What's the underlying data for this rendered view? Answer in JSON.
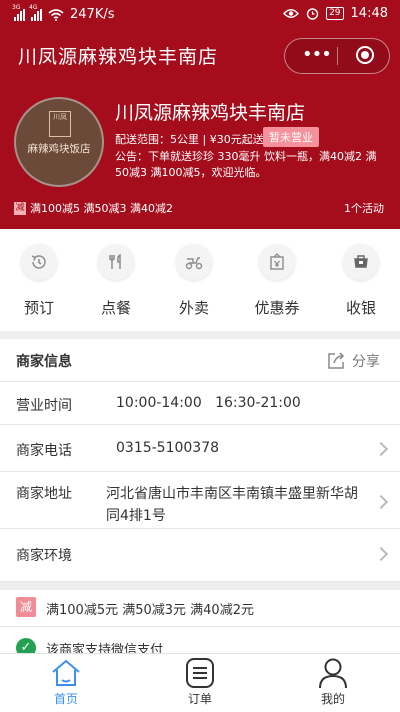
{
  "status_bar": {
    "network_1": "3G",
    "network_2": "4G",
    "speed": "247K/s",
    "battery": "29",
    "time": "14:48"
  },
  "header": {
    "title": "川凤源麻辣鸡块丰南店",
    "capsule_more_icon": "more-dots-icon",
    "capsule_close_icon": "target-circle-icon",
    "background_color": "#a50d1d"
  },
  "shop": {
    "logo_text_top": "川凤",
    "logo_text": "麻辣鸡块饭店",
    "name": "川凤源麻辣鸡块丰南店",
    "delivery_info": "配送范围：5公里 | ¥30元起送",
    "status_badge": "暂未营业",
    "notice": "公告：下单就送珍珍 330毫升 饮料一瓶，满40减2 满50减3 满100减5，欢迎光临。",
    "promo_badge": "减",
    "promo_text": "满100减5 满50减3 满40减2",
    "activity_count": "1个活动"
  },
  "quick_actions": [
    {
      "label": "预订",
      "icon": "clock-icon"
    },
    {
      "label": "点餐",
      "icon": "fork-knife-icon"
    },
    {
      "label": "外卖",
      "icon": "scooter-icon"
    },
    {
      "label": "优惠券",
      "icon": "coupon-icon"
    },
    {
      "label": "收银",
      "icon": "cashier-icon"
    }
  ],
  "merchant": {
    "section_title": "商家信息",
    "share_label": "分享",
    "hours_label": "营业时间",
    "hours_value": "10:00-14:00   16:30-21:00",
    "phone_label": "商家电话",
    "phone_value": "0315-5100378",
    "address_label": "商家地址",
    "address_value": "河北省唐山市丰南区丰南镇丰盛里新华胡同4排1号",
    "env_label": "商家环境"
  },
  "discounts": {
    "badge": "减",
    "text": "满100减5元 满50减3元 满40减2元",
    "wechat_text": "该商家支持微信支付"
  },
  "tabbar": {
    "active_color": "#3b8ff0",
    "items": [
      {
        "label": "首页",
        "icon": "home-icon"
      },
      {
        "label": "订单",
        "icon": "order-list-icon"
      },
      {
        "label": "我的",
        "icon": "user-icon"
      }
    ]
  }
}
